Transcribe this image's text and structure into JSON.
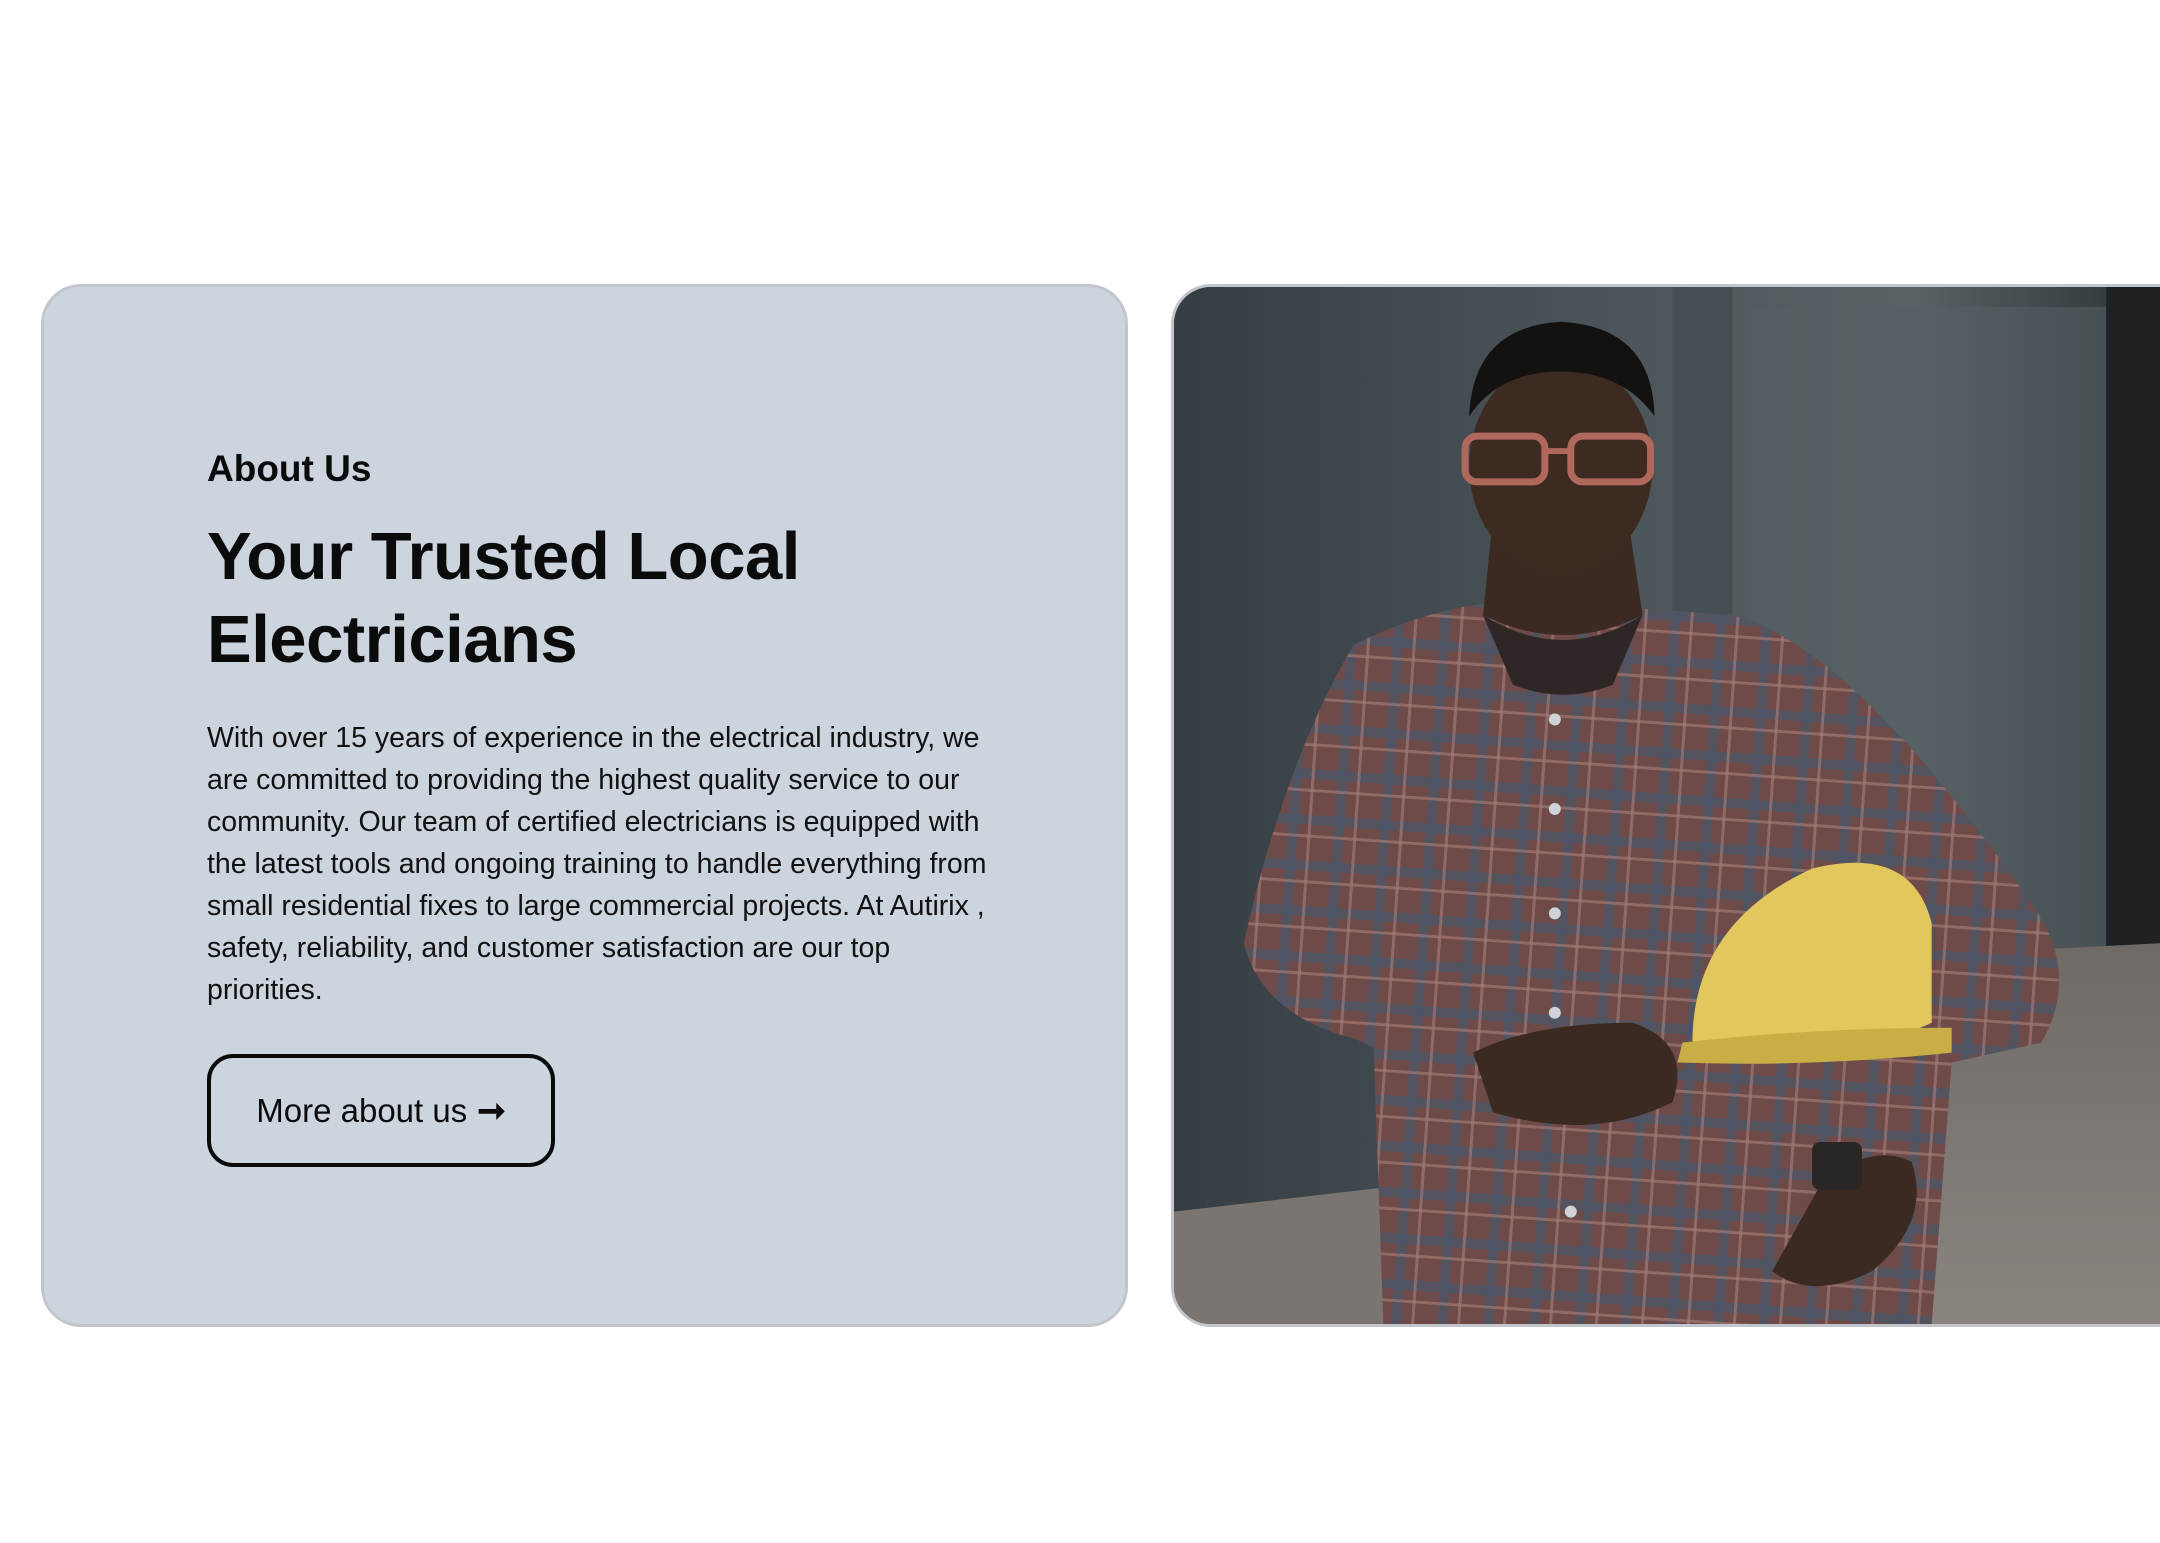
{
  "about": {
    "eyebrow": "About Us",
    "headline": "Your Trusted Local Electricians",
    "body": "With over 15 years of experience in the electrical industry, we are committed to providing the highest quality service to our community. Our team of certified electricians is equipped with the latest tools and ongoing training to handle everything from small residential fixes to large commercial projects. At Autirix , safety, reliability, and customer satisfaction are our top priorities.",
    "button_label": "More about us",
    "button_icon": "arrow-right-icon"
  },
  "photo": {
    "subject": "electrician-portrait"
  },
  "colors": {
    "card_background": "#ccd4de",
    "card_border": "#c2c6cc",
    "text": "#0b0b0b",
    "helmet": "#e2c85c"
  }
}
